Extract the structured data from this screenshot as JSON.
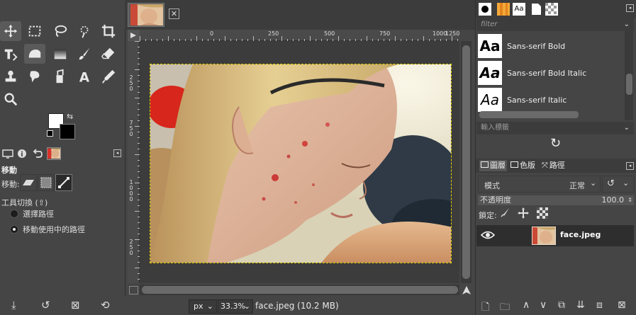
{
  "image_tab": {
    "close_label": "✕"
  },
  "ruler": {
    "h_labels": [
      "0",
      "250",
      "500",
      "750",
      "1000",
      "1250"
    ],
    "v_labels": [
      "2",
      "5",
      "0",
      "7",
      "5",
      "0",
      "1",
      "0",
      "0",
      "0",
      "2",
      "5",
      "0"
    ]
  },
  "tool_options": {
    "title": "移動",
    "move_label": "移動:",
    "toggle_label": "工具切換 (⇧)",
    "radio_pick": "選擇路徑",
    "radio_active": "移動使用中的路徑"
  },
  "status": {
    "unit": "px",
    "zoom": "33.3%",
    "info": "face.jpeg (10.2 MB)"
  },
  "fonts": {
    "filter_placeholder": "filter",
    "items": [
      {
        "sample": "Aa",
        "name": "Sans-serif Bold"
      },
      {
        "sample": "Aa",
        "name": "Sans-serif Bold Italic"
      },
      {
        "sample": "Aa",
        "name": "Sans-serif Italic"
      }
    ],
    "tag_placeholder": "輸入標籤"
  },
  "layers": {
    "tabs": [
      "圖層",
      "色版",
      "路徑"
    ],
    "mode_label": "模式",
    "mode_value": "正常",
    "opacity_label": "不透明度",
    "opacity_value": "100.0",
    "lock_label": "鎖定:",
    "layer_name": "face.jpeg"
  },
  "icons": {
    "fonts_tab": "Aa",
    "dropdown": "⌄",
    "refresh": "↻"
  },
  "colors": {
    "background": "#454545",
    "selection_border": "#e7d200"
  }
}
